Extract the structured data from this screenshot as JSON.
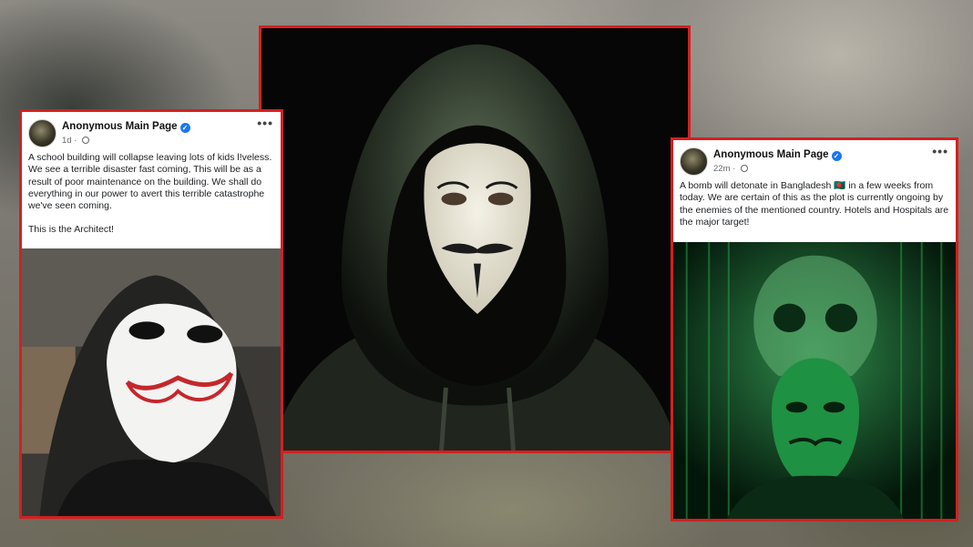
{
  "posts": [
    {
      "author": "Anonymous Main Page",
      "time": "1d",
      "text": [
        "A school building will collapse leaving lots of kids l!veless. We see a terrible disaster fast coming, This will be as a result of poor maintenance on the building. We shall do everything in our power to avert this terrible catastrophe we've seen coming.",
        "This is the Architect!"
      ],
      "image_icon": "masked-figure-photo"
    },
    {
      "author": "Anonymous Main Page",
      "time": "22m",
      "text_before_flag": "A bomb will detonate in Bangladesh",
      "flag": "🇧🇩",
      "text_after_flag": "in a few weeks from today. We are certain of this as the plot is currently ongoing by the enemies of the mentioned country. Hotels and Hospitals are the major target!",
      "image_icon": "green-skull-mask-artwork"
    }
  ],
  "icons": {
    "verified": "verified-badge-icon",
    "more": "more-options-icon",
    "audience": "globe-icon"
  },
  "colors": {
    "frame_border": "#d51f1f",
    "verified_blue": "#1877f2",
    "meta_gray": "#65676b"
  }
}
